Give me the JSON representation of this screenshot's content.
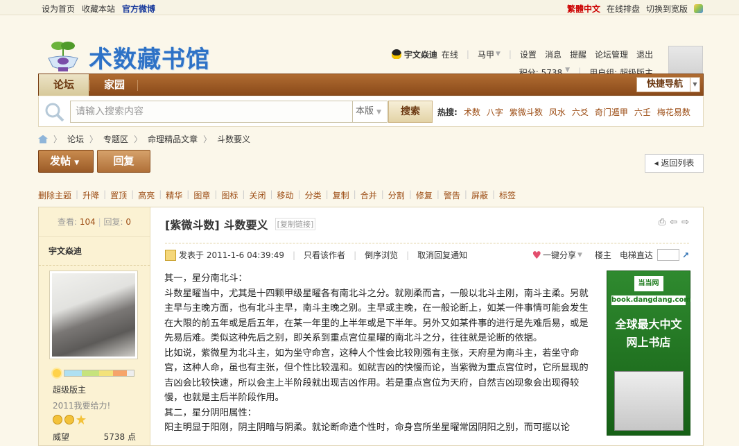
{
  "topbar": {
    "left": [
      "设为首页",
      "收藏本站",
      "官方微博"
    ],
    "right": [
      "繁體中文",
      "在线排盘",
      "切换到宽版"
    ]
  },
  "logo": {
    "text": "术数藏书馆"
  },
  "user": {
    "name": "宇文焱迪",
    "status": "在线",
    "menu": [
      "马甲",
      "设置",
      "消息",
      "提醒",
      "论坛管理",
      "退出"
    ],
    "points": "积分: 5738",
    "group": "用户组: 超级版主"
  },
  "nav": {
    "tabs": [
      "论坛",
      "家园"
    ],
    "quick": "快捷导航"
  },
  "search": {
    "placeholder": "请输入搜索内容",
    "scope": "本版",
    "button": "搜索",
    "hot_label": "热搜:",
    "hot": [
      "术数",
      "八字",
      "紫微斗数",
      "风水",
      "六爻",
      "奇门遁甲",
      "六壬",
      "梅花易数"
    ]
  },
  "breadcrumb": [
    "论坛",
    "专题区",
    "命理精品文章",
    "斗数要义"
  ],
  "actions": {
    "post": "发帖",
    "reply": "回复",
    "back": "返回列表"
  },
  "admin": [
    "删除主题",
    "升降",
    "置顶",
    "高亮",
    "精华",
    "图章",
    "图标",
    "关闭",
    "移动",
    "分类",
    "复制",
    "合并",
    "分割",
    "修复",
    "警告",
    "屏蔽",
    "标签"
  ],
  "sidebar": {
    "views_label": "查看:",
    "views": "104",
    "replies_label": "回复:",
    "replies": "0",
    "name": "宇文焱迪",
    "group": "超级版主",
    "signature": "2011我要给力!",
    "prestige_label": "威望",
    "prestige": "5738 点"
  },
  "thread": {
    "category": "[紫微斗数]",
    "title": "斗数要义",
    "copy_link": "[复制链接]",
    "posted": "发表于 2011-1-6 04:39:49",
    "only_author": "只看该作者",
    "reverse": "倒序浏览",
    "cancel_notify": "取消回复通知",
    "share": "一键分享",
    "floor": "楼主",
    "elevator": "电梯直达",
    "paragraphs": [
      "其一，星分南北斗：",
      "斗数星曜当中，尤其是十四颗甲级星曜各有南北斗之分。就刚柔而言，一般以北斗主刚，南斗主柔。另就主早与主晚方面，也有北斗主早，南斗主晚之别。主早或主晚，在一般论断上，如某一件事情可能会发生在大限的前五年或是后五年，在某一年里的上半年或是下半年。另外又如某件事的进行是先难后易，或是先易后难。类似这种先后之别，即关系到重点宫位星曜的南北斗之分，往往就是论断的依据。",
      "比如说，紫微星为北斗主，如为坐守命宫，这种人个性会比较刚强有主张，天府星为南斗主，若坐守命宫，这种人命，虽也有主张，但个性比较温和。如就吉凶的快慢而论，当紫微为重点宫位时，它所显现的吉凶会比较快速，所以会主上半阶段就出现吉凶作用。若是重点宫位为天府，自然吉凶现象会出现得较慢，也就是主后半阶段作用。",
      "其二，星分阴阳属性：",
      "阳主明显于阳刚，阴主阴暗与阴柔。就论断命造个性时，命身宫所坐星曜常因阴阳之别，而可据以论"
    ]
  },
  "ad": {
    "brand": "当当网",
    "url": "book.dangdang.com",
    "line1": "全球最大中文",
    "line2": "网上书店"
  }
}
